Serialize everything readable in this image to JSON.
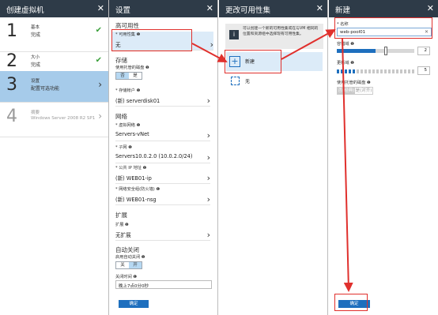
{
  "blade1": {
    "title": "创建虚拟机",
    "steps": [
      {
        "num": "1",
        "line1": "基本",
        "line2": "完成"
      },
      {
        "num": "2",
        "line1": "大小",
        "line2": "完成"
      },
      {
        "num": "3",
        "line1": "设置",
        "line2": "配置可选功能"
      },
      {
        "num": "4",
        "line1": "摘要",
        "line2": "Windows Server 2008 R2 SP1"
      }
    ]
  },
  "blade2": {
    "title": "设置",
    "ha_header": "高可用性",
    "avset_label": "* 可用性集 ❶",
    "avset_value": "无",
    "storage_header": "存储",
    "managed_disk_label": "使用托管的磁盘 ❶",
    "no_label": "否",
    "yes_label": "是",
    "storage_account_label": "* 存储帐户 ❶",
    "storage_account_value": "(新) serverdisk01",
    "network_header": "网络",
    "vnet_label": "* 虚拟网络 ❶",
    "vnet_value": "Servers-vNet",
    "subnet_label": "* 子网 ❶",
    "subnet_value": "Servers10.0.2.0 (10.0.2.0/24)",
    "pip_label": "* 公共 IP 地址 ❶",
    "pip_value": "(新) WEB01-ip",
    "nsg_label": "* 网络安全组(防火墙) ❶",
    "nsg_value": "(新) WEB01-nsg",
    "ext_header": "扩展",
    "ext_label": "扩展 ❶",
    "ext_value": "无扩展",
    "shutdown_header": "自动关闭",
    "shutdown_enable_label": "启用自动关闭 ❶",
    "off_label": "关",
    "on_label": "开",
    "shutdown_time_label": "关闭时间 ❶",
    "shutdown_time_value": "晚上7点0分0秒",
    "ok_button": "确定"
  },
  "blade3": {
    "title": "更改可用性集",
    "info_text": "可以创建一个新的可用性集或在与VM 相同的位置和资源组中选择现有可用性集。",
    "new_label": "新建",
    "none_label": "无"
  },
  "blade4": {
    "title": "新建",
    "name_label": "* 名称",
    "name_value": "web-pool01",
    "fault_domain_label": "容错域 ❶",
    "fault_domain_value": "2",
    "fault_domain_level": 0.5,
    "update_domain_label": "更新域 ❶",
    "update_domain_value": "5",
    "update_domain_level": 0.25,
    "managed_disk_label": "使用托管的磁盘 ❶",
    "classic_label": "否(经典)",
    "aligned_label": "是(对齐)",
    "ok_button": "确定"
  },
  "colors": {
    "header": "#2e3b48",
    "selected_step": "#5b9bd5",
    "highlight": "#e0302d",
    "accent": "#1e6fbe"
  }
}
